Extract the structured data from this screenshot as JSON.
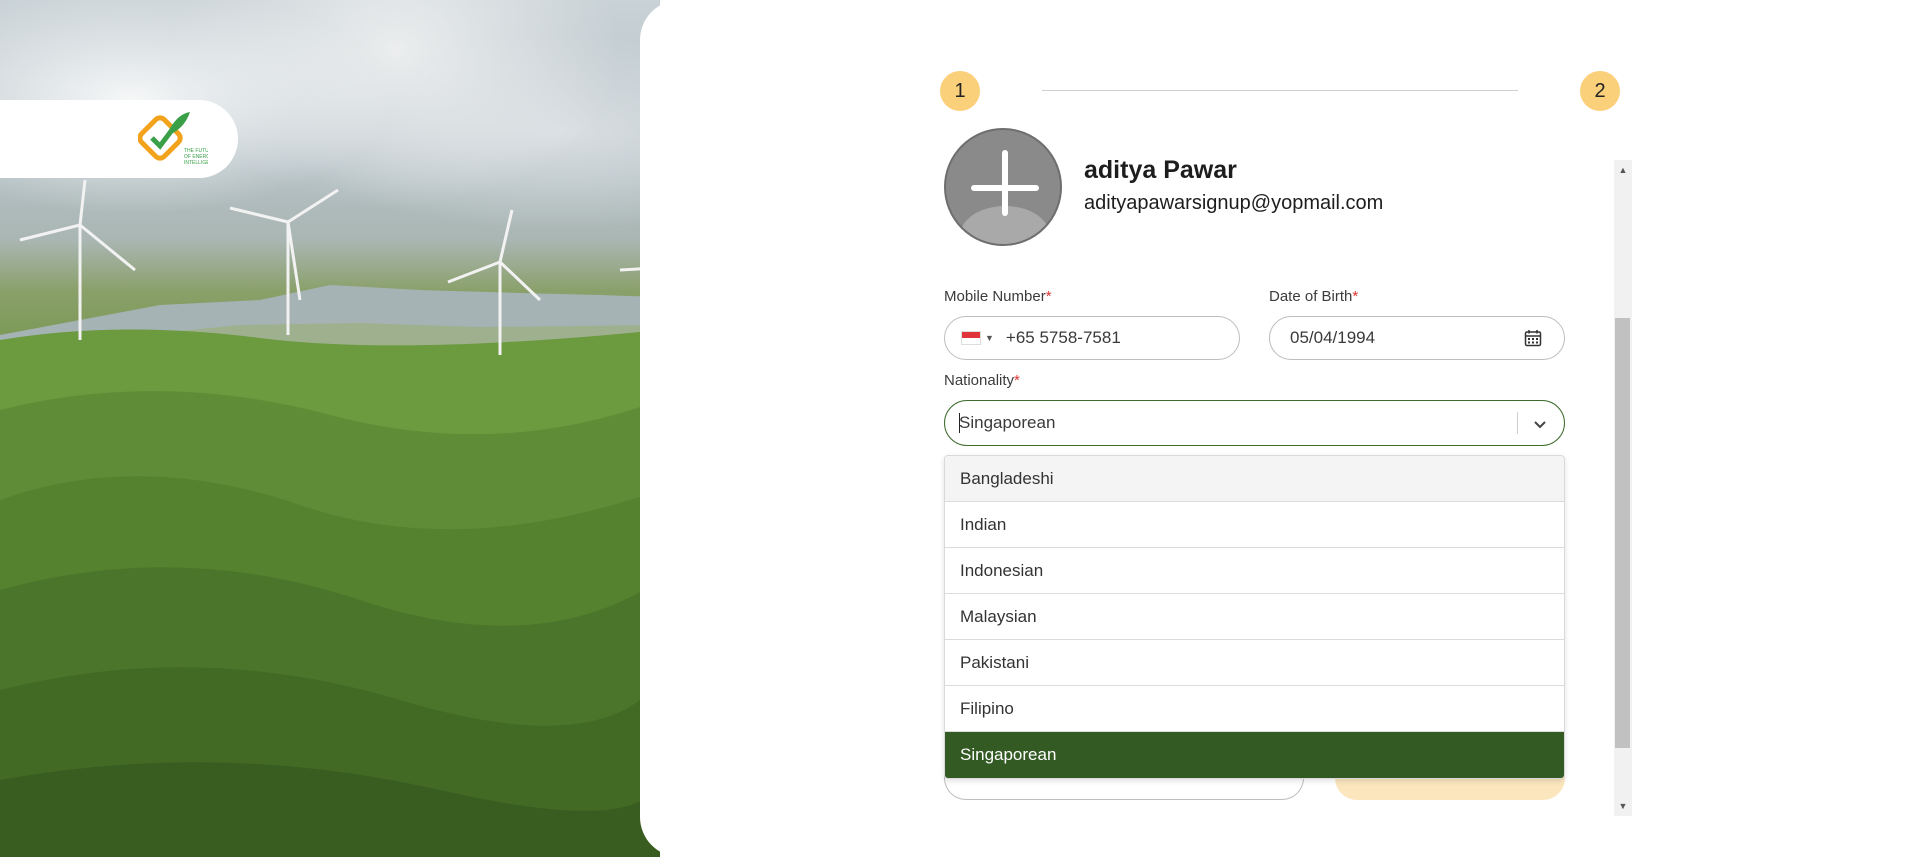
{
  "stepper": {
    "step1": "1",
    "step2": "2"
  },
  "profile": {
    "name": "aditya Pawar",
    "email": "adityapawarsignup@yopmail.com"
  },
  "form": {
    "mobile": {
      "label": "Mobile Number",
      "required_mark": "*",
      "country_flag": "singapore-flag",
      "value": "+65 5758-7581"
    },
    "dob": {
      "label": "Date of Birth",
      "required_mark": "*",
      "value": "05/04/1994",
      "icon": "calendar-icon"
    },
    "nationality": {
      "label": "Nationality",
      "required_mark": "*",
      "value": "Singaporean",
      "icon": "chevron-down-icon"
    }
  },
  "nationality_options": [
    {
      "label": "Bangladeshi"
    },
    {
      "label": "Indian"
    },
    {
      "label": "Indonesian"
    },
    {
      "label": "Malaysian"
    },
    {
      "label": "Pakistani"
    },
    {
      "label": "Filipino"
    },
    {
      "label": "Singaporean"
    }
  ],
  "colors": {
    "accent_green": "#335a23",
    "step_yellow": "#fbd07a",
    "required_red": "#d33"
  }
}
